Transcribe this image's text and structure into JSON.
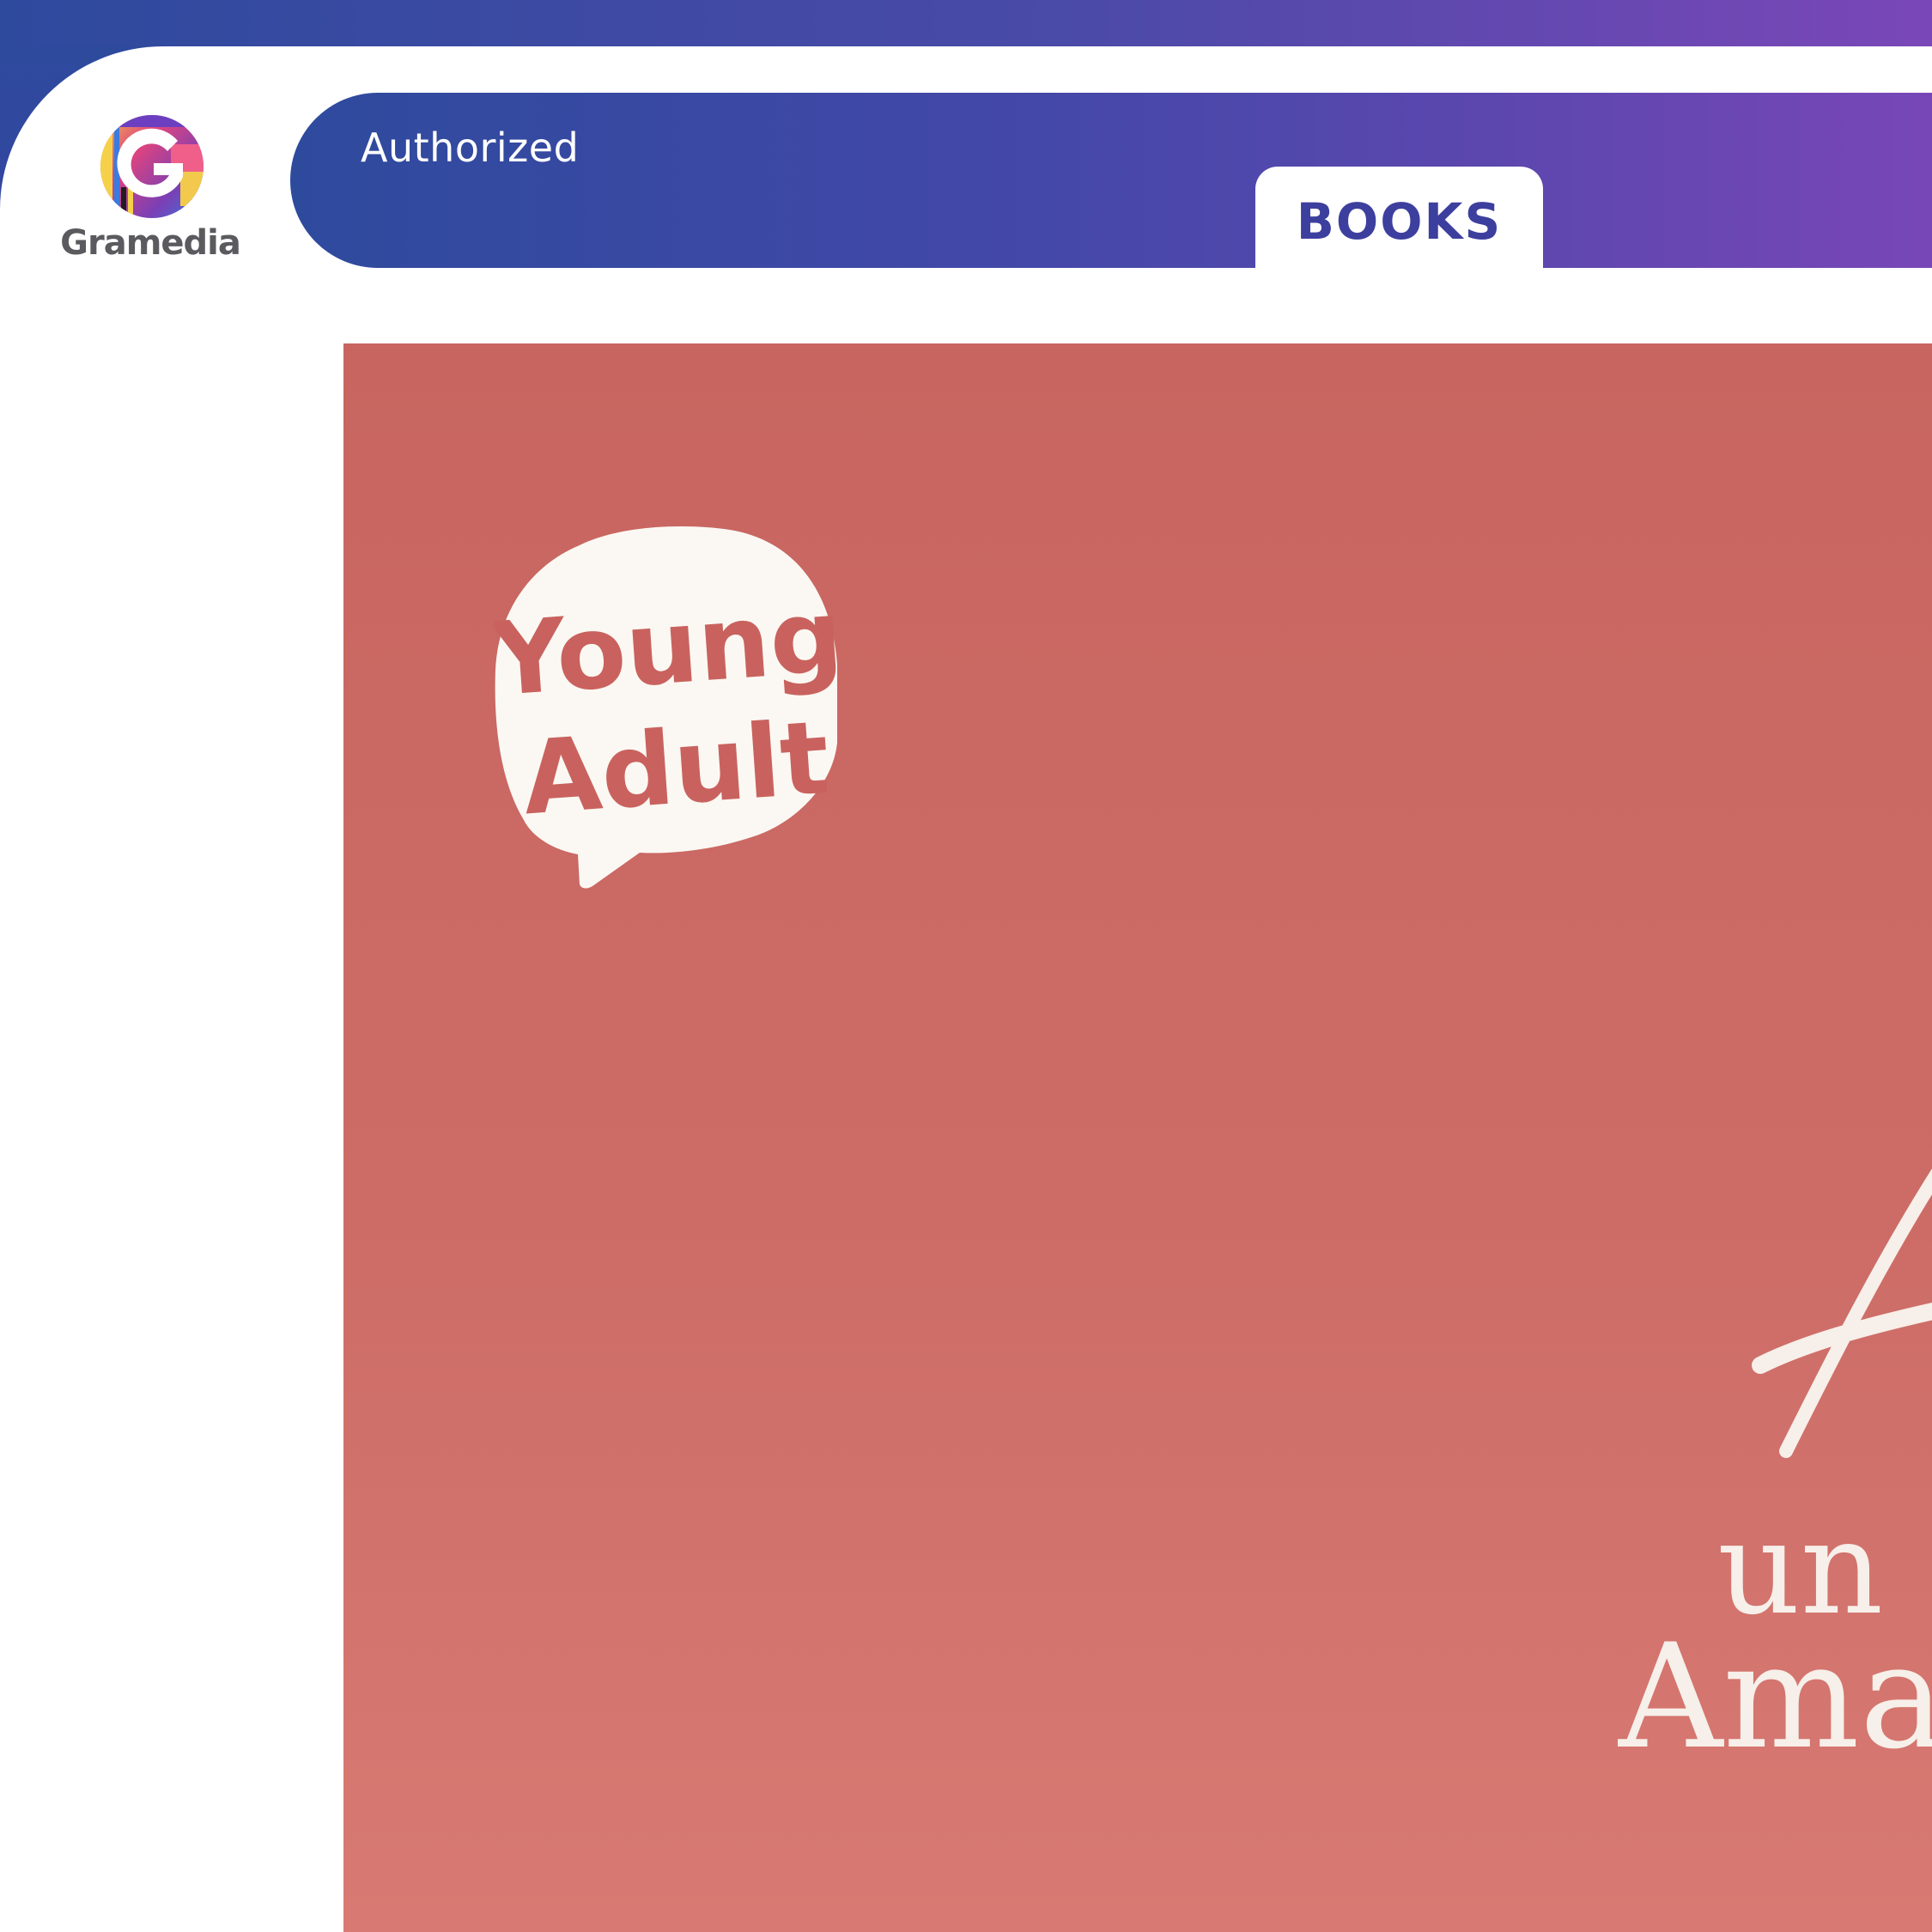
{
  "brand": {
    "logo_name": "Gramedia",
    "logo_icon": "gramedia-g-logo"
  },
  "header": {
    "badge_text": "Authorized",
    "tab_label": "BOOKS"
  },
  "cover": {
    "badge_line1": "Young",
    "badge_line2": "Adult",
    "title_fragment_1": "un",
    "title_fragment_2": "Ama",
    "background_color": "#cd6c67",
    "text_color": "#f7efe9"
  },
  "colors": {
    "header_gradient_start": "#2e4a9d",
    "header_gradient_end": "#7a47b8",
    "tab_text": "#3d3f9e"
  }
}
